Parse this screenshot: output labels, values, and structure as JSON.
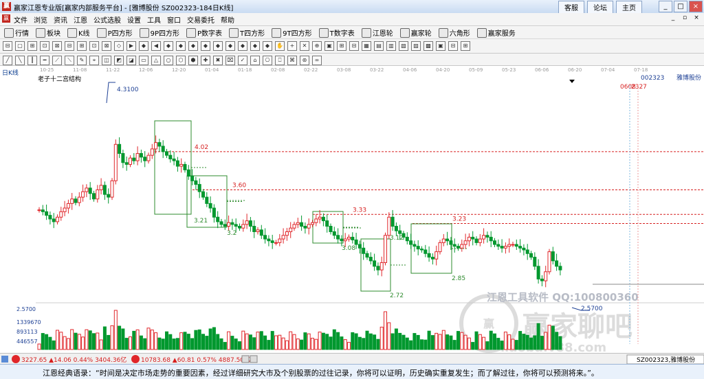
{
  "window": {
    "title": "赢家江恩专业版[赢家内部服务平台] - [雅博股份  SZ002323-184日K线]",
    "links": [
      "客服",
      "论坛",
      "主页"
    ],
    "controls": [
      "_",
      "□",
      "×"
    ]
  },
  "menu": {
    "items": [
      "文件",
      "浏览",
      "资讯",
      "江恩",
      "公式选股",
      "设置",
      "工具",
      "窗口",
      "交易委托",
      "帮助"
    ]
  },
  "toolbar": {
    "items": [
      {
        "label": "行情",
        "icon": "grid-icon"
      },
      {
        "label": "板块",
        "icon": "blocks-icon"
      },
      {
        "label": "K线",
        "icon": "kline-icon"
      },
      {
        "label": "P四方形",
        "icon": "p-square-icon"
      },
      {
        "label": "9P四方形",
        "icon": "9p-square-icon"
      },
      {
        "label": "P数字表",
        "icon": "p-table-icon"
      },
      {
        "label": "T四方形",
        "icon": "t-square-icon"
      },
      {
        "label": "9T四方形",
        "icon": "9t-square-icon"
      },
      {
        "label": "T数字表",
        "icon": "t-table-icon"
      },
      {
        "label": "江恩轮",
        "icon": "gann-wheel-icon"
      },
      {
        "label": "赢家轮",
        "icon": "winner-wheel-icon"
      },
      {
        "label": "六角形",
        "icon": "hexagon-icon"
      },
      {
        "label": "赢家服务",
        "icon": "dollar-icon"
      }
    ]
  },
  "chart": {
    "period_label": "日K线",
    "indicator_name": "老子十二宫结构",
    "stock_code": "002323",
    "stock_name": "雅博股份",
    "cursor_date_label": "0608",
    "cursor_value_label": "2327",
    "dates": [
      "10-25",
      "11-08",
      "11-22",
      "12-06",
      "12-20",
      "01-04",
      "01-18",
      "02-08",
      "02-22",
      "03-08",
      "03-22",
      "04-06",
      "04-20",
      "05-09",
      "05-23",
      "06-06",
      "06-20",
      "07-04",
      "07-18"
    ],
    "high_label": "4.3100",
    "low_label": "2.5700",
    "levels": [
      {
        "label": "4.02"
      },
      {
        "label": "3.60"
      },
      {
        "label": "3.33"
      },
      {
        "label": "3.23"
      }
    ],
    "box_labels": [
      "3.21",
      "3.2",
      "3.08",
      "3.12",
      "2.72",
      "2.85"
    ],
    "volume_axis": [
      "2.5700",
      "1339670",
      "893113",
      "446557"
    ],
    "watermark_line1": "江恩工具软件  QQ:100800360",
    "watermark_line2": "赢家聊吧",
    "watermark_line3": "liaoba.v88.com",
    "colors": {
      "up": "#e0262a",
      "down": "#00982e",
      "box": "#2e8b2e",
      "level": "#d61f1f",
      "axis_text": "#1c3f94"
    }
  },
  "sheetbar": {
    "sh_index": "3227.65 ▲14.06 0.44% 3404.36亿",
    "sz_index": "10783.68 ▲60.81 0.57% 4887.50亿",
    "tab_label": "SZ002323,雅博股份"
  },
  "status": {
    "quote": "江恩经典语录：“时间是决定市场走势的重要因素，经过详细研究大市及个别股票的过往记录，你将可以证明，历史确实重复发生；而了解过往，你将可以预测将来。”。"
  }
}
